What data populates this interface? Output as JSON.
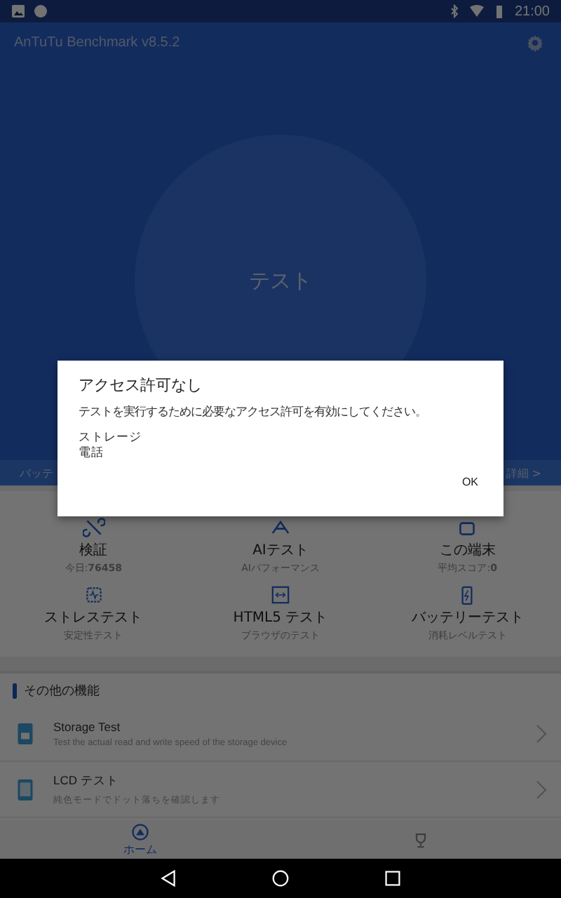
{
  "status_bar": {
    "time": "21:00"
  },
  "app_bar": {
    "title": "AnTuTu Benchmark v8.5.2"
  },
  "start_button": {
    "label": "テスト"
  },
  "battery_strip": {
    "label": "バッテ",
    "details_link": "詳細 >"
  },
  "tests": [
    {
      "kind": "verify",
      "title": "検証",
      "subtitle": "今日:**76458**"
    },
    {
      "kind": "ai",
      "title": "AIテスト",
      "subtitle": "AIパフォーマンス"
    },
    {
      "kind": "device",
      "title": "この端末",
      "subtitle": "平均スコア:**0**"
    },
    {
      "kind": "stress",
      "title": "ストレステスト",
      "subtitle": "安定性テスト"
    },
    {
      "kind": "html5",
      "title": "HTML5 テスト",
      "subtitle": "ブラウザのテスト"
    },
    {
      "kind": "battery",
      "title": "バッテリーテスト",
      "subtitle": "消耗レベルテスト"
    }
  ],
  "other_features": {
    "heading": "その他の機能",
    "items": [
      {
        "kind": "storage",
        "title": "Storage Test",
        "description": "Test the actual read and write speed of the storage device"
      },
      {
        "kind": "lcd",
        "title": "LCD テスト",
        "description": "純色モードでドット落ちを確認します"
      }
    ]
  },
  "bottom_nav": [
    {
      "kind": "home",
      "label": "ホーム",
      "selected": true
    },
    {
      "kind": "ranking",
      "selected": false
    }
  ],
  "dialog": {
    "title": "アクセス許可なし",
    "message": "テストを実行するために必要なアクセス許可を有効にしてください。",
    "permissions": [
      "ストレージ",
      "電話"
    ],
    "button": "OK"
  }
}
